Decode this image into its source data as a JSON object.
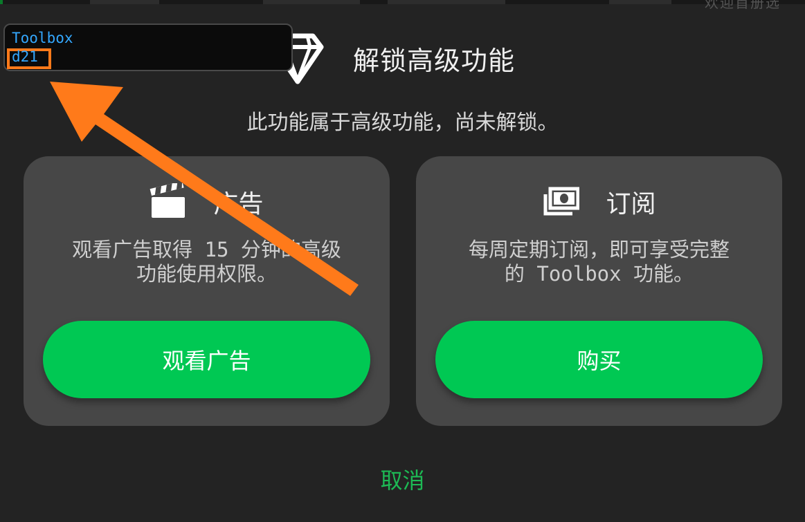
{
  "top_bar": {
    "partial_text": "欢迎首册选"
  },
  "overlay": {
    "app_name": "Toolbox",
    "code": "d21"
  },
  "dialog": {
    "title": "解锁高级功能",
    "subtitle": "此功能属于高级功能，尚未解锁。",
    "icon": "diamond-icon"
  },
  "cards": {
    "ad": {
      "icon": "clapperboard-icon",
      "title": "广告",
      "description_line1": "观看广告取得 15 分钟的高级",
      "description_line2": "功能使用权限。",
      "button_label": "观看广告"
    },
    "subscription": {
      "icon": "money-icon",
      "title": "订阅",
      "description_line1": "每周定期订阅，即可享受完整",
      "description_line2": "的 Toolbox 功能。",
      "button_label": "购买"
    }
  },
  "cancel_label": "取消",
  "colors": {
    "background": "#232323",
    "card": "#474747",
    "accent_green": "#00c853",
    "cancel_green": "#1db954",
    "annotation_orange": "#ff7a1a",
    "overlay_text_blue": "#34a8ff"
  }
}
